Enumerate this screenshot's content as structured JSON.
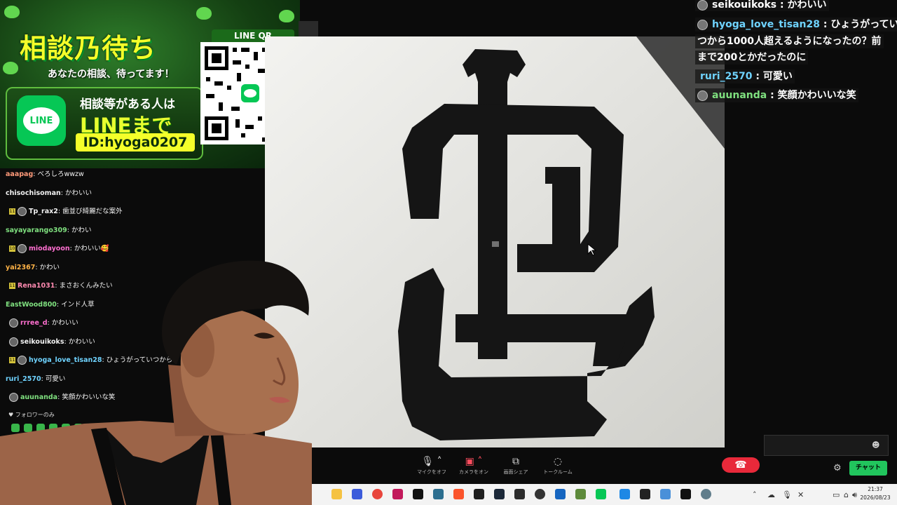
{
  "banner": {
    "title": "相談乃待ち",
    "subtitle": "あなたの相談、待ってます！",
    "line_logo": "LINE",
    "line1": "相談等がある人は",
    "line2": "LINEまで",
    "line_id": "ID:hyoga0207",
    "qr_label": "LINE QR"
  },
  "left_chat": [
    {
      "user": "aaapag",
      "msg": "べろしろwwzw",
      "color": "#ff9a7a",
      "badge": "",
      "avatar": false
    },
    {
      "user": "chisochisoman",
      "msg": "かわいい",
      "color": "#ffffff",
      "badge": "",
      "avatar": false
    },
    {
      "user": "Tp_rax2",
      "msg": "歯並び綺麗だな案外",
      "color": "#ffffff",
      "badge": "11",
      "avatar": true
    },
    {
      "user": "sayayarango309",
      "msg": "かわい",
      "color": "#7fe07f",
      "badge": "",
      "avatar": false
    },
    {
      "user": "miodayoon",
      "msg": "かわいい🥰",
      "color": "#ff6fd0",
      "badge": "10",
      "avatar": true
    },
    {
      "user": "yai2367",
      "msg": "かわい",
      "color": "#ffb347",
      "badge": "",
      "avatar": false
    },
    {
      "user": "Rena1031",
      "msg": "まさおくんみたい",
      "color": "#ff8ab0",
      "badge": "11",
      "avatar": false
    },
    {
      "user": "EastWood800",
      "msg": "インド人草",
      "color": "#7fe07f",
      "badge": "",
      "avatar": false
    },
    {
      "user": "rrree_d",
      "msg": "かわいい",
      "color": "#ff6fd0",
      "badge": "",
      "avatar": true
    },
    {
      "user": "seikouikoks",
      "msg": "かわいい",
      "color": "#ffffff",
      "badge": "",
      "avatar": true
    },
    {
      "user": "hyoga_love_tisan28",
      "msg": "ひょうがっていつから1",
      "color": "#6fd3ff",
      "badge": "11",
      "avatar": true
    },
    {
      "user": "ruri_2570",
      "msg": "可愛い",
      "color": "#6fd3ff",
      "badge": "",
      "avatar": false
    },
    {
      "user": "auunanda",
      "msg": "笑顔かわいいな笑",
      "color": "#7fe07f",
      "badge": "",
      "avatar": true
    }
  ],
  "follower_only": "フォロワーのみ",
  "right_chat": [
    {
      "user": "seikouikoks",
      "msg": "かわいい",
      "color": "#ffffff"
    },
    {
      "user": "hyoga_love_tisan28",
      "msg": "ひょうがってい",
      "color": "#6fd3ff",
      "cont": [
        "つから1000人超えるようになったの？前",
        "まで200とかだったのに"
      ]
    },
    {
      "user": "ruri_2570",
      "msg": "可愛い",
      "color": "#6fd3ff"
    },
    {
      "user": "auunanda",
      "msg": "笑顔かわいいな笑",
      "color": "#7fe07f"
    }
  ],
  "controls": {
    "mic": "マイクをオフ",
    "camera": "カメラをオン",
    "share": "画面シェア",
    "talkroom": "トークルーム"
  },
  "chat_button": "チャット",
  "clock": {
    "time": "21:37",
    "date": "2026/08/23"
  },
  "colors": {
    "line_green": "#06c755",
    "chat_green": "#21c55d",
    "hangup_red": "#e8293a"
  }
}
